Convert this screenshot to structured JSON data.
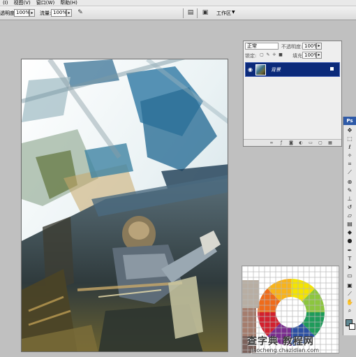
{
  "menu": [
    "(I)",
    "视图(V)",
    "窗口(W)",
    "帮助(H)"
  ],
  "options": {
    "opacity_label": "透明度:",
    "opacity_value": "100%",
    "flow_label": "流量:",
    "flow_value": "100%",
    "workspace_label": "工作区"
  },
  "layers": {
    "blend_mode": "正常",
    "opacity_label": "不透明度:",
    "opacity_value": "100%",
    "lock_label": "锁定:",
    "fill_label": "填充:",
    "fill_value": "100%",
    "layer_name": "背景"
  },
  "tools": {
    "header": "Ps",
    "foreground_color": "#5f8791",
    "background_color": "#ffffff",
    "items": [
      "move-icon",
      "marquee-icon",
      "lasso-icon",
      "magic-wand-icon",
      "crop-icon",
      "slice-icon",
      "healing-icon",
      "brush-icon",
      "stamp-icon",
      "history-brush-icon",
      "eraser-icon",
      "gradient-icon",
      "blur-icon",
      "dodge-icon",
      "pen-icon",
      "type-icon",
      "path-select-icon",
      "shape-icon",
      "notes-icon",
      "eyedropper-icon",
      "hand-icon",
      "zoom-icon"
    ]
  },
  "watermark": {
    "main": "查字典 教程网",
    "url": "jiaocheng.chazidian.com"
  }
}
